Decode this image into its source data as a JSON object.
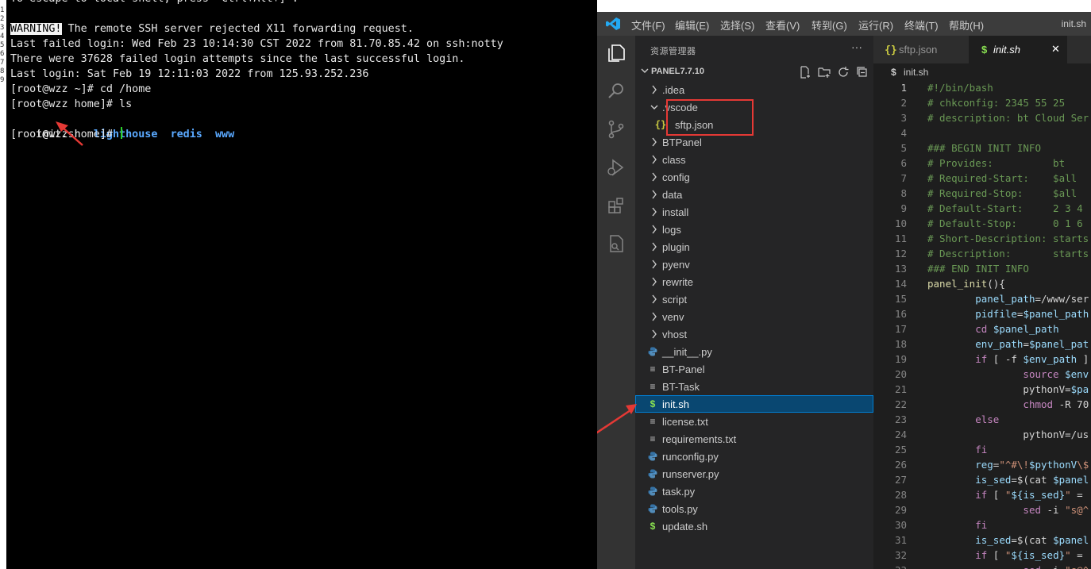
{
  "gutter_chars": [
    "1",
    "2",
    "3",
    "4",
    "5",
    "6",
    "7",
    "8",
    "9"
  ],
  "terminal": {
    "lines": [
      {
        "text": "To escape to local shell, press 'Ctrl+Alt+]'."
      },
      {
        "text": ""
      },
      {
        "warn": "WARNING!",
        "text": " The remote SSH server rejected X11 forwarding request."
      },
      {
        "text": "Last failed login: Wed Feb 23 10:14:30 CST 2022 from 81.70.85.42 on ssh:notty"
      },
      {
        "text": "There were 37628 failed login attempts since the last successful login."
      },
      {
        "text": "Last login: Sat Feb 19 12:11:03 2022 from 125.93.252.236"
      },
      {
        "text": "[root@wzz ~]# cd /home"
      },
      {
        "text": "[root@wzz home]# ls"
      }
    ],
    "ls_output": {
      "file": "init.sh",
      "dirs": [
        "lighthouse",
        "redis",
        "www"
      ]
    },
    "prompt": "[root@wzz home]# "
  },
  "vscode": {
    "menu": [
      "文件(F)",
      "编辑(E)",
      "选择(S)",
      "查看(V)",
      "转到(G)",
      "运行(R)",
      "终端(T)",
      "帮助(H)"
    ],
    "window_title": "init.sh",
    "explorer_title": "资源管理器",
    "more": "···",
    "workspace": "PANEL7.7.10",
    "tree": [
      {
        "label": ".idea",
        "kind": "folder",
        "level": 0,
        "open": false
      },
      {
        "label": ".vscode",
        "kind": "folder",
        "level": 0,
        "open": true
      },
      {
        "label": "sftp.json",
        "kind": "json",
        "level": 1
      },
      {
        "label": "BTPanel",
        "kind": "folder",
        "level": 0,
        "open": false
      },
      {
        "label": "class",
        "kind": "folder",
        "level": 0,
        "open": false
      },
      {
        "label": "config",
        "kind": "folder",
        "level": 0,
        "open": false
      },
      {
        "label": "data",
        "kind": "folder",
        "level": 0,
        "open": false
      },
      {
        "label": "install",
        "kind": "folder",
        "level": 0,
        "open": false
      },
      {
        "label": "logs",
        "kind": "folder",
        "level": 0,
        "open": false
      },
      {
        "label": "plugin",
        "kind": "folder",
        "level": 0,
        "open": false
      },
      {
        "label": "pyenv",
        "kind": "folder",
        "level": 0,
        "open": false
      },
      {
        "label": "rewrite",
        "kind": "folder",
        "level": 0,
        "open": false
      },
      {
        "label": "script",
        "kind": "folder",
        "level": 0,
        "open": false
      },
      {
        "label": "venv",
        "kind": "folder",
        "level": 0,
        "open": false
      },
      {
        "label": "vhost",
        "kind": "folder",
        "level": 0,
        "open": false
      },
      {
        "label": "__init__.py",
        "kind": "py",
        "level": 0
      },
      {
        "label": "BT-Panel",
        "kind": "txt",
        "level": 0
      },
      {
        "label": "BT-Task",
        "kind": "txt",
        "level": 0
      },
      {
        "label": "init.sh",
        "kind": "sh",
        "level": 0,
        "selected": true
      },
      {
        "label": "license.txt",
        "kind": "txt",
        "level": 0
      },
      {
        "label": "requirements.txt",
        "kind": "txt",
        "level": 0
      },
      {
        "label": "runconfig.py",
        "kind": "py",
        "level": 0
      },
      {
        "label": "runserver.py",
        "kind": "py",
        "level": 0
      },
      {
        "label": "task.py",
        "kind": "py",
        "level": 0
      },
      {
        "label": "tools.py",
        "kind": "py",
        "level": 0
      },
      {
        "label": "update.sh",
        "kind": "sh",
        "level": 0
      }
    ],
    "tabs": [
      {
        "icon": "{}",
        "label": "sftp.json",
        "active": false
      },
      {
        "icon": "$",
        "label": "init.sh",
        "active": true,
        "close": "✕"
      }
    ],
    "breadcrumb": "init.sh",
    "code": [
      "#!/bin/bash",
      "# chkconfig: 2345 55 25",
      "# description: bt Cloud Ser",
      "",
      "### BEGIN INIT INFO",
      "# Provides:          bt",
      "# Required-Start:    $all",
      "# Required-Stop:     $all",
      "# Default-Start:     2 3 4",
      "# Default-Stop:      0 1 6",
      "# Short-Description: starts",
      "# Description:       starts",
      "### END INIT INFO",
      "panel_init(){",
      "        panel_path=/www/ser",
      "        pidfile=$panel_path",
      "        cd $panel_path",
      "        env_path=$panel_pat",
      "        if [ -f $env_path ]",
      "                source $env",
      "                pythonV=$pa",
      "                chmod -R 70",
      "        else",
      "                pythonV=/us",
      "        fi",
      "        reg=\"^#\\!$pythonV\\$",
      "        is_sed=$(cat $panel",
      "        if [ \"${is_sed}\" =",
      "                sed -i \"s@^",
      "        fi",
      "        is_sed=$(cat $panel",
      "        if [ \"${is_sed}\" =",
      "                sed -i \"s@^"
    ],
    "current_line": 1
  },
  "colors": {
    "annotation_red": "#e53935",
    "selection": "#094771",
    "terminal_dir": "#5aa9ff"
  }
}
